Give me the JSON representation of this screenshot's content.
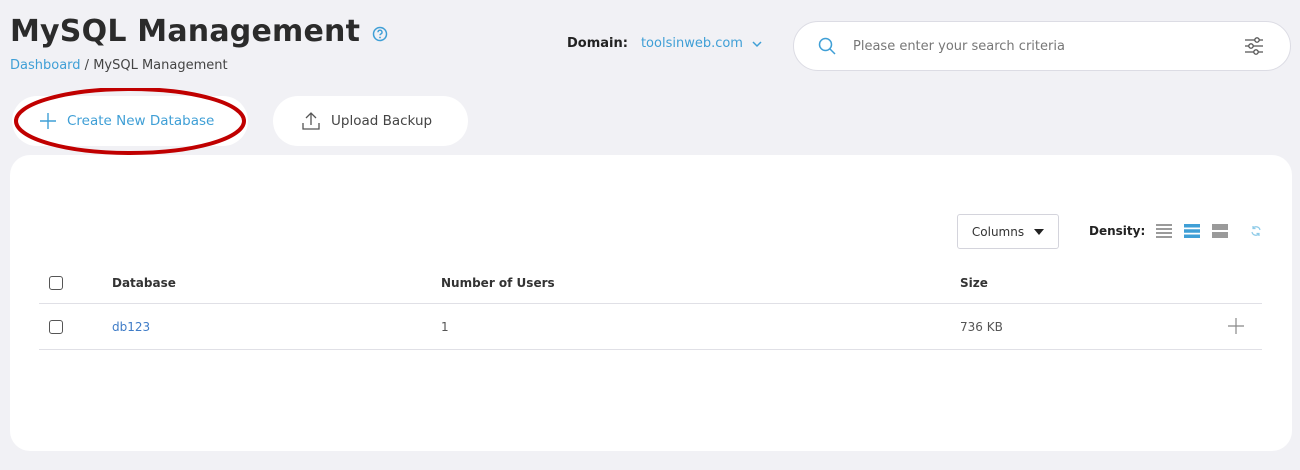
{
  "header": {
    "title": "MySQL Management",
    "breadcrumb": {
      "link": "Dashboard",
      "separator": " / ",
      "current": "MySQL Management"
    }
  },
  "domain": {
    "label": "Domain:",
    "value": "toolsinweb.com"
  },
  "search": {
    "placeholder": "Please enter your search criteria"
  },
  "actions": {
    "create_label": "Create New Database",
    "upload_label": "Upload Backup"
  },
  "toolbar": {
    "columns_label": "Columns",
    "density_label": "Density:"
  },
  "table": {
    "headers": [
      "Database",
      "Number of Users",
      "Size"
    ],
    "rows": [
      {
        "database": "db123",
        "users": "1",
        "size": "736 KB"
      }
    ]
  },
  "colors": {
    "accent": "#3f9fd6",
    "highlight_annotation": "#c00000"
  },
  "icons": [
    "help-icon",
    "chevron-down-icon",
    "search-icon",
    "filter-icon",
    "plus-icon",
    "upload-icon",
    "caret-down-icon",
    "density-compact-icon",
    "density-standard-icon",
    "density-comfortable-icon",
    "refresh-icon",
    "expand-plus-icon"
  ]
}
